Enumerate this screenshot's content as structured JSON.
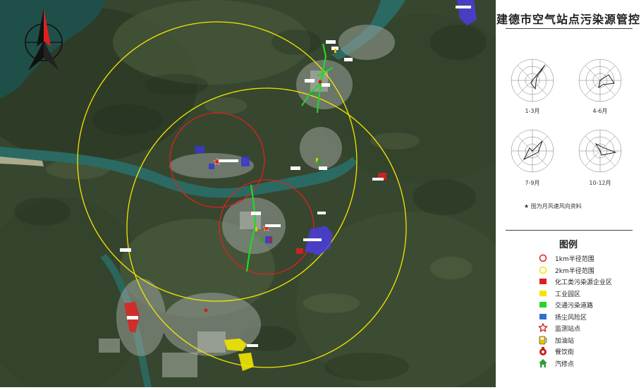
{
  "title": "建德市空气站点污染源管控",
  "wind_roses": {
    "labels": [
      "1-3月",
      "4-6月",
      "7-9月",
      "10-12月"
    ],
    "note": "★ 图为月风速风向资料"
  },
  "legend": {
    "title": "图例",
    "items": [
      {
        "label": "1km半径范围",
        "icon": "circle-red-outline",
        "color": "#e0201f"
      },
      {
        "label": "2km半径范围",
        "icon": "circle-yellow-outline",
        "color": "#f2e600"
      },
      {
        "label": "化工类污染源企业区",
        "icon": "square-red",
        "color": "#e0201f"
      },
      {
        "label": "工业园区",
        "icon": "square-yellow",
        "color": "#f2e600"
      },
      {
        "label": "交通污染道路",
        "icon": "square-green",
        "color": "#22d62a"
      },
      {
        "label": "扬尘风险区",
        "icon": "square-blue",
        "color": "#2f6fd0"
      },
      {
        "label": "监测站点",
        "icon": "star-icon",
        "color": "#c81e1e"
      },
      {
        "label": "加油站",
        "icon": "fuel-icon",
        "color": "#e6c200"
      },
      {
        "label": "餐饮街",
        "icon": "restaurant-icon",
        "color": "#c81e1e"
      },
      {
        "label": "汽修点",
        "icon": "house-icon",
        "color": "#2f9e3a"
      }
    ]
  },
  "map": {
    "colors": {
      "satellite_base": "#3a4a30",
      "river": "#2a6a62",
      "town": "#9aa29a"
    },
    "compass": "north-arrow-icon"
  }
}
